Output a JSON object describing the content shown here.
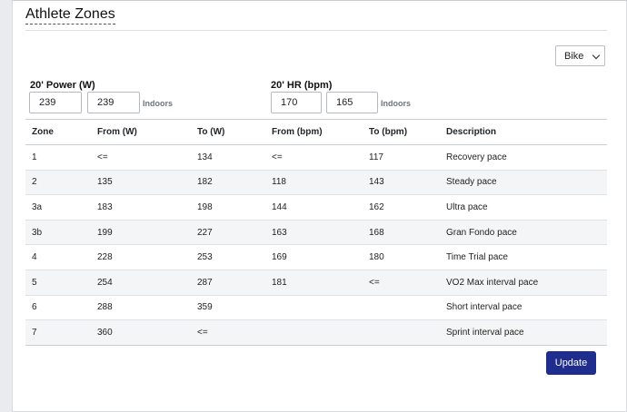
{
  "page": {
    "title": "Athlete Zones"
  },
  "sport_select": {
    "value": "Bike"
  },
  "power": {
    "label": "20' Power (W)",
    "value1": "239",
    "value2": "239",
    "note": "Indoors"
  },
  "hr": {
    "label": "20' HR (bpm)",
    "value1": "170",
    "value2": "165",
    "note": "Indoors"
  },
  "table": {
    "headers": [
      "Zone",
      "From (W)",
      "To (W)",
      "From (bpm)",
      "To (bpm)",
      "Description"
    ],
    "rows": [
      [
        "1",
        "<=",
        "134",
        "<=",
        "117",
        "Recovery pace"
      ],
      [
        "2",
        "135",
        "182",
        "118",
        "143",
        "Steady pace"
      ],
      [
        "3a",
        "183",
        "198",
        "144",
        "162",
        "Ultra pace"
      ],
      [
        "3b",
        "199",
        "227",
        "163",
        "168",
        "Gran Fondo pace"
      ],
      [
        "4",
        "228",
        "253",
        "169",
        "180",
        "Time Trial pace"
      ],
      [
        "5",
        "254",
        "287",
        "181",
        "<=",
        "VO2 Max interval pace"
      ],
      [
        "6",
        "288",
        "359",
        "",
        "",
        "Short interval pace"
      ],
      [
        "7",
        "360",
        "<=",
        "",
        "",
        "Sprint interval pace"
      ]
    ]
  },
  "buttons": {
    "update": "Update"
  }
}
